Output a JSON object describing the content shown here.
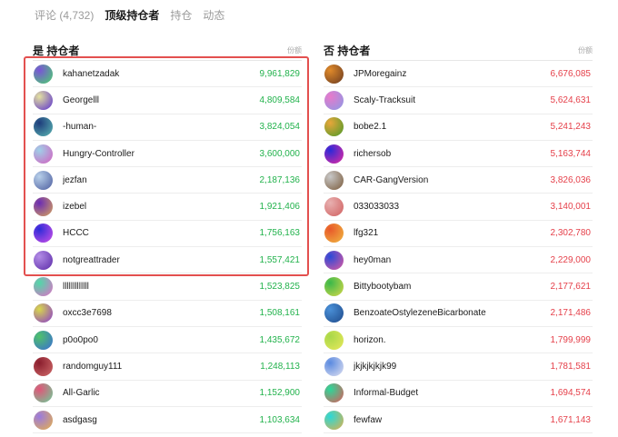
{
  "tabs": [
    {
      "label": "评论 (4,732)",
      "active": false
    },
    {
      "label": "顶级持仓者",
      "active": true
    },
    {
      "label": "持仓",
      "active": false
    },
    {
      "label": "动态",
      "active": false
    }
  ],
  "yes_holders": {
    "title": "是 持仓者",
    "sub": "份额",
    "rows": [
      {
        "name": "kahanetzadak",
        "amount": "9,961,829",
        "avatar": [
          "#7a52d8",
          "#4bd46c"
        ]
      },
      {
        "name": "Georgelll",
        "amount": "4,809,584",
        "avatar": [
          "#e4e2a0",
          "#5a2fcf"
        ]
      },
      {
        "name": "-human-",
        "amount": "3,824,054",
        "avatar": [
          "#1e3c7c",
          "#5bb7b3"
        ]
      },
      {
        "name": "Hungry-Controller",
        "amount": "3,600,000",
        "avatar": [
          "#9fd0e8",
          "#d45fc0"
        ]
      },
      {
        "name": "jezfan",
        "amount": "2,187,136",
        "avatar": [
          "#b8d0ea",
          "#4b5c9e"
        ]
      },
      {
        "name": "izebel",
        "amount": "1,921,406",
        "avatar": [
          "#6a2bb4",
          "#d9a65a"
        ]
      },
      {
        "name": "HCCC",
        "amount": "1,756,163",
        "avatar": [
          "#2c2cd8",
          "#d04fe8"
        ]
      },
      {
        "name": "notgreattrader",
        "amount": "1,557,421",
        "avatar": [
          "#b38de6",
          "#5b2aa8"
        ]
      },
      {
        "name": "lllllllllllll",
        "amount": "1,523,825",
        "avatar": [
          "#4fd8a8",
          "#e46ec8"
        ]
      },
      {
        "name": "oxcc3e7698",
        "amount": "1,508,161",
        "avatar": [
          "#d8d84a",
          "#8a3ad0"
        ]
      },
      {
        "name": "p0o0po0",
        "amount": "1,435,672",
        "avatar": [
          "#4fc26a",
          "#3a6cd6"
        ]
      },
      {
        "name": "randomguy111",
        "amount": "1,248,113",
        "avatar": [
          "#8a1e2e",
          "#d06a6a"
        ]
      },
      {
        "name": "All-Garlic",
        "amount": "1,152,900",
        "avatar": [
          "#e25478",
          "#6ad09a"
        ]
      },
      {
        "name": "asdgasg",
        "amount": "1,103,634",
        "avatar": [
          "#9a7ae0",
          "#e6b04a"
        ]
      }
    ]
  },
  "no_holders": {
    "title": "否 持仓者",
    "sub": "份额",
    "rows": [
      {
        "name": "JPMoregainz",
        "amount": "6,676,085",
        "avatar": [
          "#e08a2a",
          "#6a3a20"
        ]
      },
      {
        "name": "Scaly-Tracksuit",
        "amount": "5,624,631",
        "avatar": [
          "#e87acb",
          "#8a9ae6"
        ]
      },
      {
        "name": "bobe2.1",
        "amount": "5,241,243",
        "avatar": [
          "#e8a63a",
          "#4b9a2a"
        ]
      },
      {
        "name": "richersob",
        "amount": "5,163,744",
        "avatar": [
          "#2a2ad8",
          "#e82aa0"
        ]
      },
      {
        "name": "CAR-GangVersion",
        "amount": "3,826,036",
        "avatar": [
          "#c8c8c8",
          "#7a5a3a"
        ]
      },
      {
        "name": "033033033",
        "amount": "3,140,001",
        "avatar": [
          "#e8b0b0",
          "#d06060"
        ]
      },
      {
        "name": "lfg321",
        "amount": "2,302,780",
        "avatar": [
          "#e8582a",
          "#f0b840"
        ]
      },
      {
        "name": "hey0man",
        "amount": "2,229,000",
        "avatar": [
          "#2a4ad8",
          "#e05aa0"
        ]
      },
      {
        "name": "Bittybootybam",
        "amount": "2,177,621",
        "avatar": [
          "#3ab84a",
          "#d8d84a"
        ]
      },
      {
        "name": "BenzoateOstylezeneBicarbonate",
        "amount": "2,171,486",
        "avatar": [
          "#4a90d8",
          "#1e4a8a"
        ]
      },
      {
        "name": "horizon.",
        "amount": "1,799,999",
        "avatar": [
          "#a8d84a",
          "#e8e85a"
        ]
      },
      {
        "name": "jkjkjkjkjk99",
        "amount": "1,781,581",
        "avatar": [
          "#5a8ae0",
          "#e0e0f0"
        ]
      },
      {
        "name": "Informal-Budget",
        "amount": "1,694,574",
        "avatar": [
          "#2ad89a",
          "#e05a5a"
        ]
      },
      {
        "name": "fewfaw",
        "amount": "1,671,143",
        "avatar": [
          "#2ad8d8",
          "#e0b04a"
        ]
      }
    ]
  }
}
